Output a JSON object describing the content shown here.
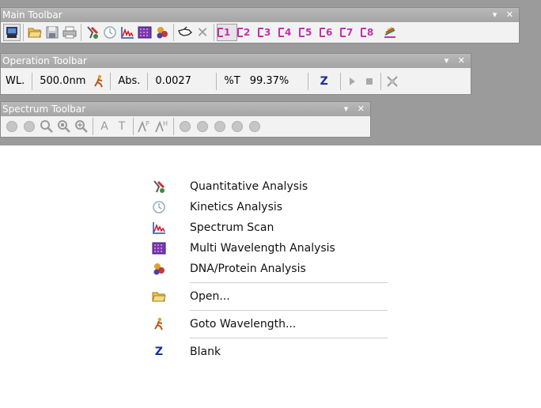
{
  "main_toolbar": {
    "title": "Main Toolbar",
    "controls": "▾ ✕",
    "channels": [
      "1",
      "2",
      "3",
      "4",
      "5",
      "6",
      "7",
      "8"
    ]
  },
  "operation_toolbar": {
    "title": "Operation Toolbar",
    "controls": "▾ ✕",
    "wl_label": "WL.",
    "wl_value": "500.0nm",
    "abs_label": "Abs.",
    "abs_value": "0.0027",
    "t_label": "%T",
    "t_value": "99.37%",
    "blank_symbol": "Z"
  },
  "spectrum_toolbar": {
    "title": "Spectrum Toolbar",
    "controls": "▾ ✕",
    "text_a": "A",
    "text_t": "T"
  },
  "menu": {
    "items": [
      {
        "label": "Quantitative Analysis",
        "icon": "quantitative-icon"
      },
      {
        "label": "Kinetics Analysis",
        "icon": "kinetics-icon"
      },
      {
        "label": "Spectrum Scan",
        "icon": "spectrum-scan-icon"
      },
      {
        "label": "Multi Wavelength Analysis",
        "icon": "multi-wavelength-icon"
      },
      {
        "label": "DNA/Protein Analysis",
        "icon": "dna-protein-icon"
      },
      {
        "label": "Open...",
        "icon": "open-folder-icon"
      },
      {
        "label": "Goto Wavelength...",
        "icon": "goto-wavelength-icon"
      },
      {
        "label": "Blank",
        "icon": "blank-icon"
      }
    ],
    "blank_symbol": "Z"
  },
  "colors": {
    "channel_magenta": "#c62eb0",
    "title_bar_gray": "#aaaaaa",
    "blank_blue": "#1a2ca0"
  }
}
